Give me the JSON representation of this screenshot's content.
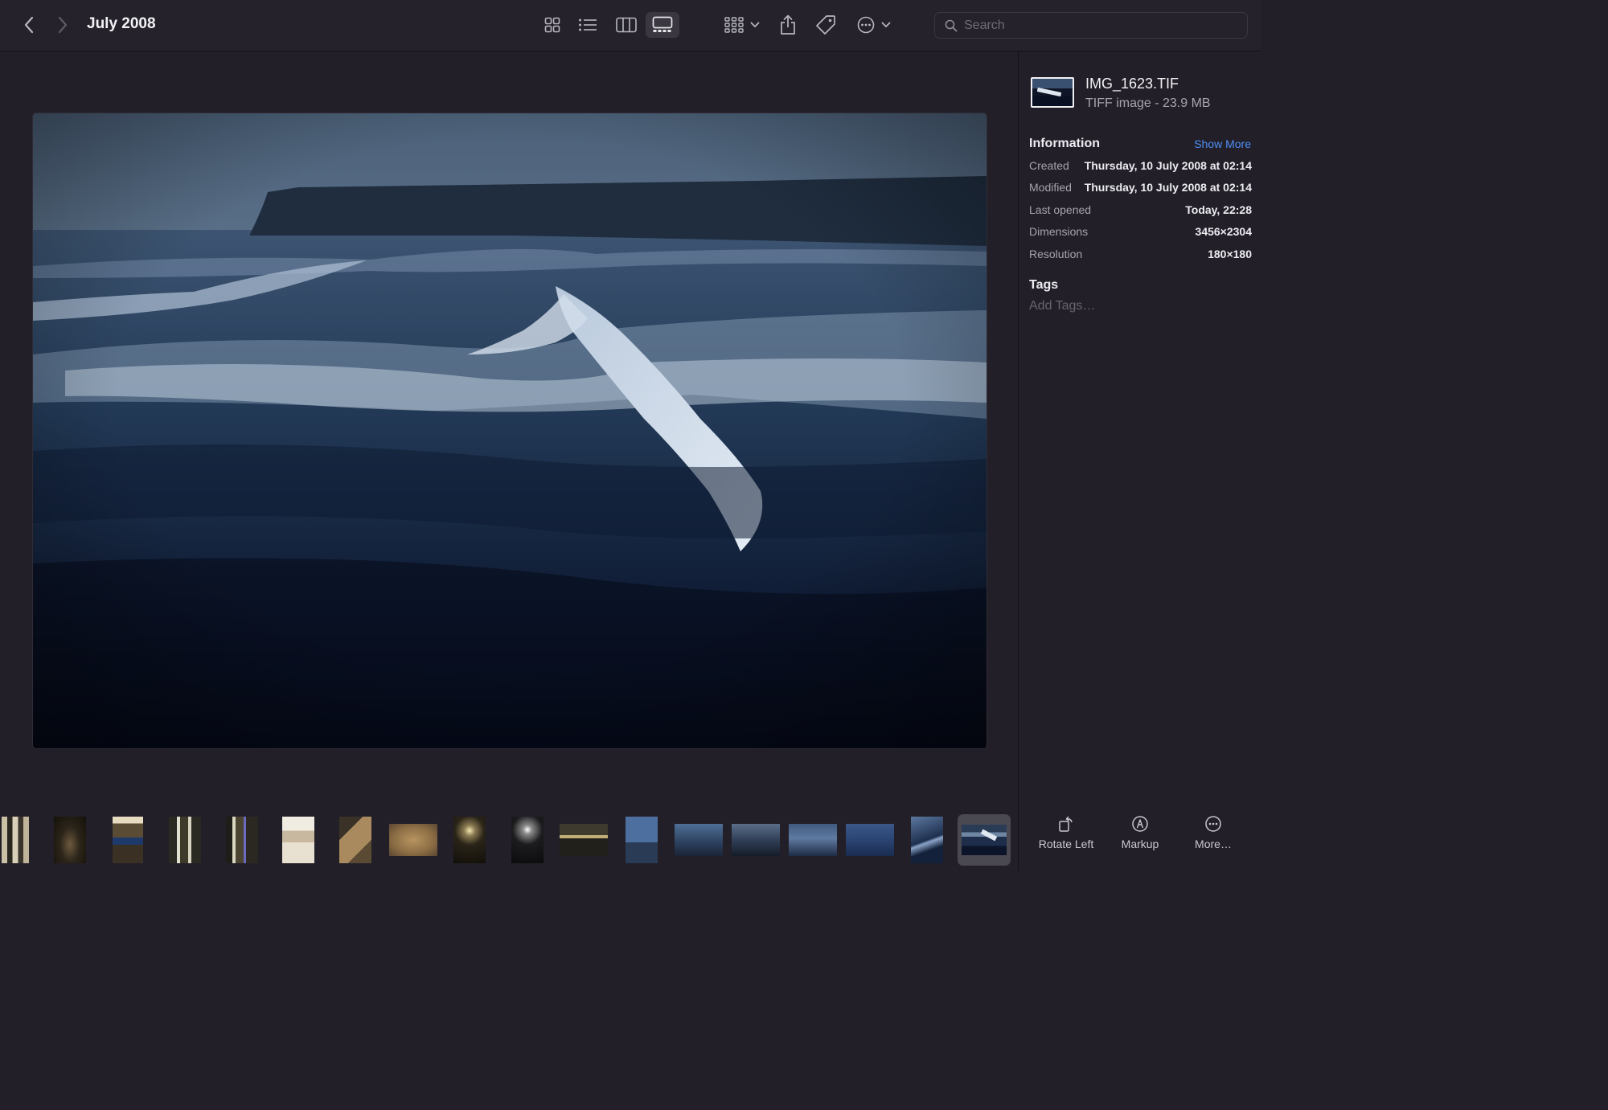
{
  "window": {
    "title": "July 2008"
  },
  "toolbar": {
    "back_icon": "chevron-left-icon",
    "forward_icon": "chevron-right-icon",
    "view_modes": [
      "icon-view-icon",
      "list-view-icon",
      "column-view-icon",
      "gallery-view-icon"
    ],
    "active_view": "gallery",
    "group_icon": "group-by-icon",
    "share_icon": "share-icon",
    "tag_icon": "tag-icon",
    "action_icon": "ellipsis-circle-icon"
  },
  "search": {
    "placeholder": "Search",
    "value": ""
  },
  "sidebar": {
    "file_name": "IMG_1623.TIF",
    "file_kind": "TIFF image - 23.9 MB",
    "information_title": "Information",
    "show_more": "Show More",
    "info": [
      {
        "key": "Created",
        "value": "Thursday, 10 July 2008 at 02:14"
      },
      {
        "key": "Modified",
        "value": "Thursday, 10 July 2008 at 02:14"
      },
      {
        "key": "Last opened",
        "value": "Today, 22:28"
      },
      {
        "key": "Dimensions",
        "value": "3456×2304"
      },
      {
        "key": "Resolution",
        "value": "180×180"
      }
    ],
    "tags_title": "Tags",
    "tags_placeholder": "Add Tags…",
    "actions": [
      {
        "label": "Rotate Left",
        "icon": "rotate-left-icon"
      },
      {
        "label": "Markup",
        "icon": "markup-icon"
      },
      {
        "label": "More…",
        "icon": "ellipsis-circle-icon"
      }
    ]
  },
  "filmstrip": {
    "count": 18,
    "selected_index": 17
  },
  "colors": {
    "background": "#221f28",
    "accent": "#4f8ff7",
    "selection": "#4a4850"
  }
}
